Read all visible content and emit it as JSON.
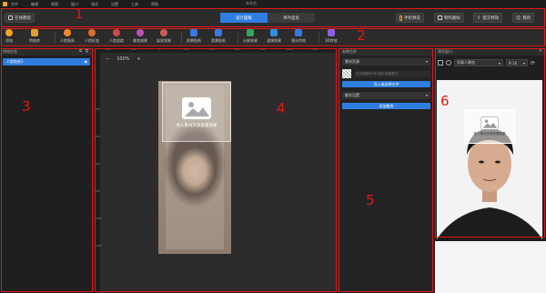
{
  "menubar": {
    "items": [
      "文件",
      "编辑",
      "视图",
      "窗口",
      "调试",
      "设置",
      "工具",
      "帮助"
    ],
    "window_title": "未命名"
  },
  "topbar": {
    "tutorial_label": "在线教程",
    "tabs": [
      {
        "label": "设计面板",
        "active": true
      },
      {
        "label": "事件面板",
        "active": false
      }
    ],
    "phone_preview_label": "手机预览",
    "make_icon_label": "制作图标",
    "submit_label": "提交特效",
    "mine_label": "我的"
  },
  "toolbar": {
    "items": [
      {
        "label": "添加",
        "color": "#f5a623"
      },
      {
        "label": "特效库",
        "color": "#e0a030"
      },
      {
        "label": "人脸贴纸",
        "color": "#f08a24"
      },
      {
        "label": "人脸形变",
        "color": "#e07030"
      },
      {
        "label": "人脸追踪",
        "color": "#d04848"
      },
      {
        "label": "美妆效果",
        "color": "#c050b8"
      },
      {
        "label": "染发效果",
        "color": "#d05a5a"
      },
      {
        "label": "前景贴纸",
        "color": "#3a78e0"
      },
      {
        "label": "背景贴纸",
        "color": "#3a78e0"
      },
      {
        "label": "分屏效果",
        "color": "#2fa860"
      },
      {
        "label": "滤镜效果",
        "color": "#2f8de0"
      },
      {
        "label": "镜头特效",
        "color": "#3a78e0"
      },
      {
        "label": "3D特效",
        "color": "#8a60e0"
      }
    ]
  },
  "layers": {
    "title": "特效信息",
    "items": [
      "人脸贴纸1"
    ]
  },
  "canvas": {
    "zoom": "100%",
    "ruler_h": [
      "400",
      "200",
      "0",
      "200",
      "400",
      "600",
      "800",
      "1000",
      "1200"
    ],
    "ruler_v": [
      "0",
      "200",
      "400",
      "600",
      "800",
      "1000",
      "1200"
    ],
    "import_hint": "导入素材资源查看效果"
  },
  "params": {
    "title": "参数信息",
    "material_section": "素材资源",
    "material_hint": "支持摄像机PNG图片视频素材",
    "import_button": "导入或选择文件",
    "trigger_section": "触发设置",
    "add_trigger_button": "添加触发"
  },
  "preview": {
    "title": "预览窗口",
    "model_select": "男章人静态",
    "ratio_select": "9:16",
    "overlay_hint": "导入素材资源查看效果"
  },
  "annotations": [
    "1",
    "2",
    "3",
    "4",
    "5",
    "6"
  ]
}
